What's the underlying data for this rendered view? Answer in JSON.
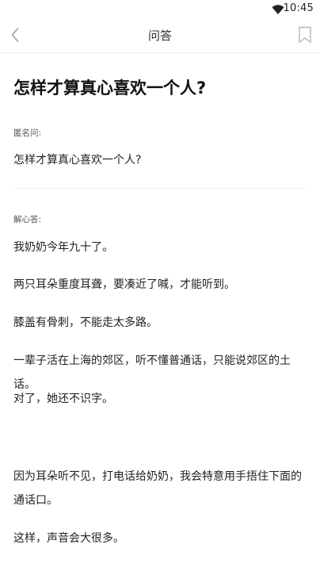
{
  "status_bar": {
    "time": "10:45",
    "wifi_icon": "wifi-icon"
  },
  "nav": {
    "title": "问答",
    "back_icon": "chevron-left-icon",
    "bookmark_icon": "bookmark-icon"
  },
  "question": {
    "title": "怎样才算真心喜欢一个人?",
    "label": "匿名问:",
    "text": "怎样才算真心喜欢一个人?"
  },
  "answer": {
    "label": "解心答:",
    "paragraphs": [
      "我奶奶今年九十了。",
      "两只耳朵重度耳聋，要凑近了喊，才能听到。",
      "膝盖有骨刺，不能走太多路。",
      "一辈子活在上海的郊区，听不懂普通话，只能说郊区的土话。",
      "对了，她还不识字。",
      "因为耳朵听不见，打电话给奶奶，我会特意用手捂住下面的通话口。",
      "这样，声音会大很多。"
    ]
  }
}
